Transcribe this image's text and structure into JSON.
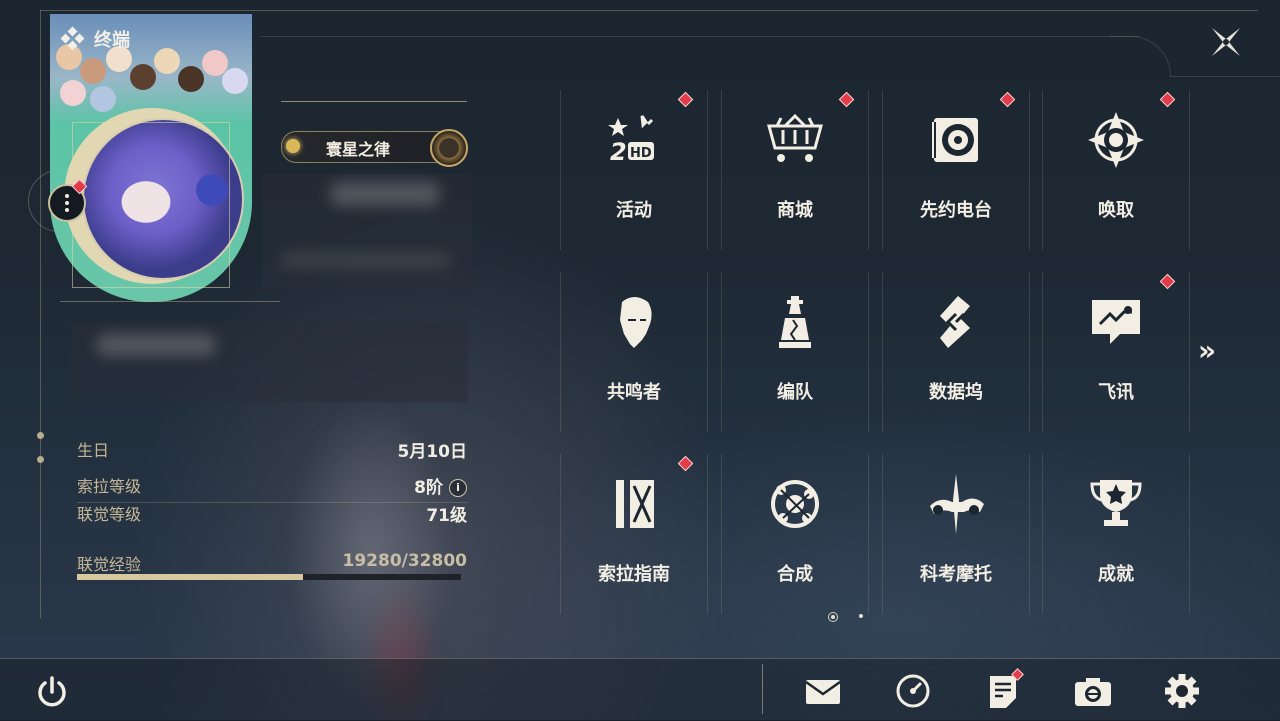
{
  "header": {
    "title": "终端",
    "title_icon": "diamond-grid-icon",
    "close_icon": "close-star-icon"
  },
  "profile": {
    "title_badge": "寰星之律",
    "stats": [
      {
        "label": "生日",
        "value": "5月10日"
      },
      {
        "label": "索拉等级",
        "value": "8阶",
        "has_info": true
      },
      {
        "label": "联觉等级",
        "value": "71级"
      }
    ],
    "xp": {
      "label": "联觉经验",
      "value": "19280/32800",
      "current": 19280,
      "max": 32800
    }
  },
  "menu": {
    "items": [
      {
        "label": "活动",
        "icon": "activity-2hd-icon",
        "badge": true
      },
      {
        "label": "商城",
        "icon": "shop-cart-icon",
        "badge": true
      },
      {
        "label": "先约电台",
        "icon": "radio-record-icon",
        "badge": true
      },
      {
        "label": "唤取",
        "icon": "summon-compass-icon",
        "badge": true
      },
      {
        "label": "共鸣者",
        "icon": "resonator-head-icon",
        "badge": false
      },
      {
        "label": "编队",
        "icon": "team-chess-icon",
        "badge": false
      },
      {
        "label": "数据坞",
        "icon": "data-dock-icon",
        "badge": false
      },
      {
        "label": "飞讯",
        "icon": "message-chat-icon",
        "badge": true
      },
      {
        "label": "索拉指南",
        "icon": "guide-book-icon",
        "badge": true
      },
      {
        "label": "合成",
        "icon": "synthesis-orbit-icon",
        "badge": false
      },
      {
        "label": "科考摩托",
        "icon": "motorcycle-icon",
        "badge": false
      },
      {
        "label": "成就",
        "icon": "trophy-icon",
        "badge": false
      }
    ],
    "next_page_icon": "double-chevron-right-icon",
    "pages": 2,
    "current_page": 1
  },
  "bottom_bar": {
    "power_icon": "power-icon",
    "buttons": [
      {
        "icon": "mail-icon",
        "badge": false
      },
      {
        "icon": "clock-icon",
        "badge": false
      },
      {
        "icon": "notice-icon",
        "badge": true
      },
      {
        "icon": "camera-icon",
        "badge": false
      },
      {
        "icon": "settings-gear-icon",
        "badge": false
      }
    ]
  },
  "colors": {
    "accent_gold": "#d8c8a0",
    "badge_red": "#e23b4a",
    "text_light": "#f2eee4",
    "label_gold": "#c6b896"
  }
}
